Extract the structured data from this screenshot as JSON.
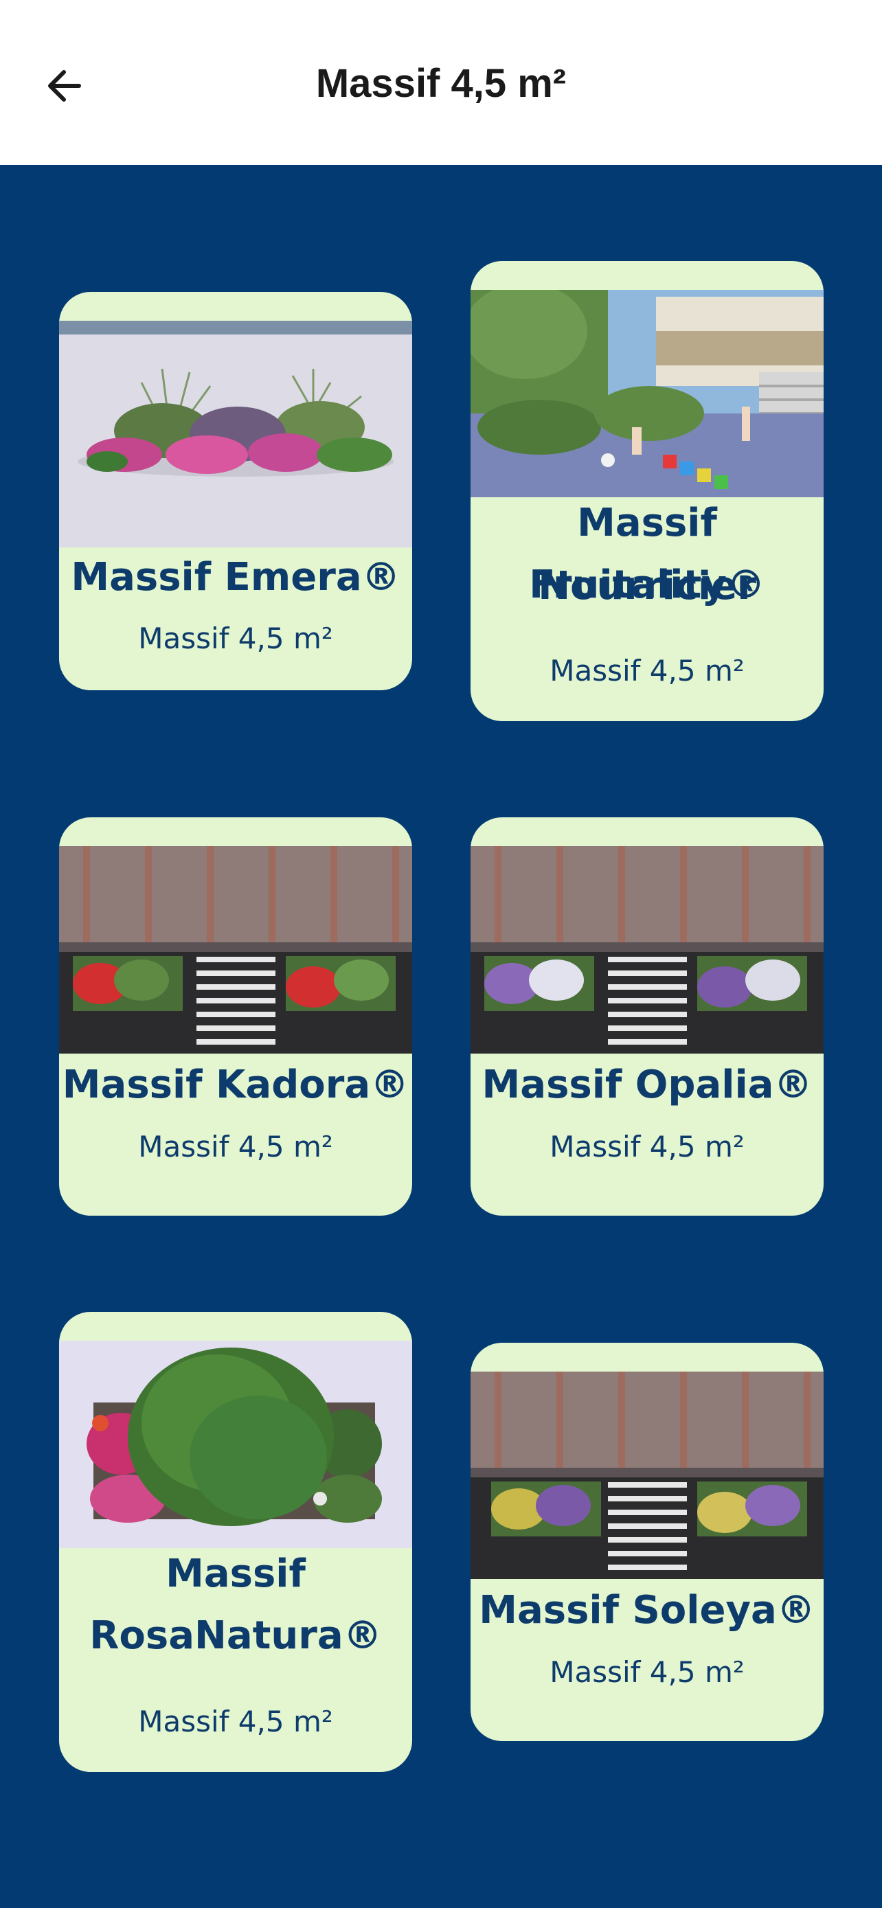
{
  "header": {
    "title": "Massif 4,5 m²",
    "back_icon": "arrow-left-icon"
  },
  "cards": [
    {
      "name": "Massif Emera®",
      "subtitle": "Massif 4,5 m²",
      "image": "planter-front-view"
    },
    {
      "name": "Massif Nourricier Fruitality®",
      "name_line1": "Massif Nourricier",
      "name_line2": "Fruitality®",
      "subtitle": "Massif 4,5 m²",
      "image": "schoolyard-scene"
    },
    {
      "name": "Massif Kadora®",
      "subtitle": "Massif 4,5 m²",
      "image": "street-aerial-red"
    },
    {
      "name": "Massif Opalia®",
      "subtitle": "Massif 4,5 m²",
      "image": "street-aerial-purple"
    },
    {
      "name": "Massif RosaNatura®",
      "name_line1": "Massif",
      "name_line2": "RosaNatura®",
      "subtitle": "Massif 4,5 m²",
      "image": "planter-top-view"
    },
    {
      "name": "Massif Soleya®",
      "subtitle": "Massif 4,5 m²",
      "image": "street-aerial-yellow"
    }
  ],
  "colors": {
    "background": "#033a72",
    "card": "#e4f6d0",
    "text": "#0d3b6b"
  }
}
